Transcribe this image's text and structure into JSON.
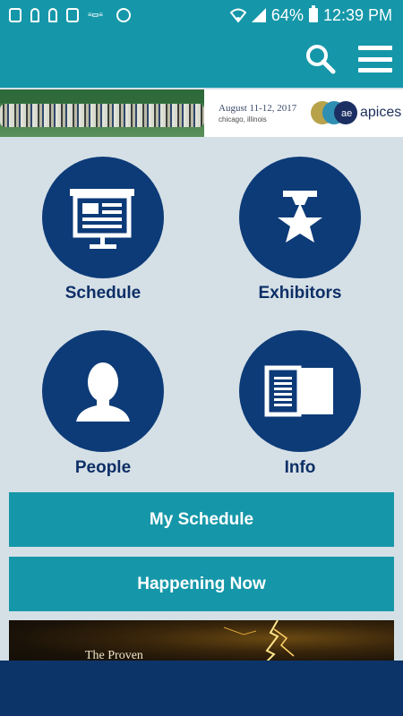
{
  "status_bar": {
    "battery": "64%",
    "time": "12:39 PM"
  },
  "banner": {
    "date": "August 11-12, 2017",
    "place": "chicago, illinois",
    "brand": "apices",
    "logo_letters": "ae"
  },
  "tiles": [
    {
      "label": "Schedule",
      "icon": "presentation-board-icon"
    },
    {
      "label": "Exhibitors",
      "icon": "star-badge-icon"
    },
    {
      "label": "People",
      "icon": "person-icon"
    },
    {
      "label": "Info",
      "icon": "open-book-icon"
    }
  ],
  "buttons": {
    "my_schedule": "My Schedule",
    "happening_now": "Happening Now"
  },
  "ad": {
    "text": "The Proven"
  },
  "colors": {
    "teal": "#1597a9",
    "navy": "#0d3b78",
    "background": "#d5e0e6"
  }
}
